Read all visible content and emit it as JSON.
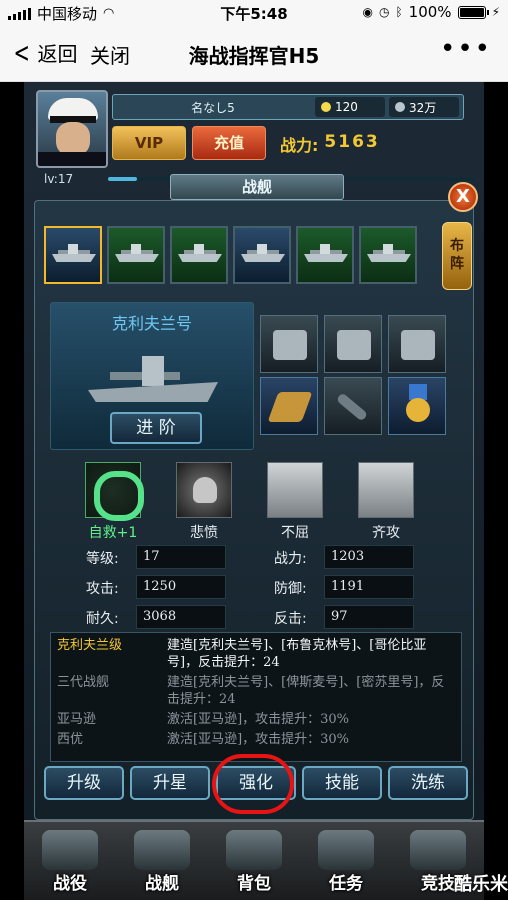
{
  "statusbar": {
    "carrier": "中国移动",
    "time": "下午5:48",
    "battery": "100%"
  },
  "navbar": {
    "back_label": "返回",
    "close_label": "关闭",
    "title": "海战指挥官H5",
    "more_label": "•••"
  },
  "player": {
    "name": "名なし5",
    "gold": "120",
    "silver": "32万",
    "level": "lv:17",
    "level_progress": 0.08,
    "vip_label": "VIP",
    "charge_label": "充值",
    "power_label": "战力:",
    "power_value": "5163"
  },
  "panel": {
    "title": "战舰",
    "close_label": "X",
    "formation_label_1": "布",
    "formation_label_2": "阵"
  },
  "ship": {
    "name": "克利夫兰号",
    "advance_label": "进 阶"
  },
  "skills": [
    {
      "name": "自救+1"
    },
    {
      "name": "悲愤"
    },
    {
      "name": "不屈"
    },
    {
      "name": "齐攻"
    }
  ],
  "stats": {
    "level_label": "等级:",
    "level_value": "17",
    "power_label": "战力:",
    "power_value": "1203",
    "attack_label": "攻击:",
    "attack_value": "1250",
    "defense_label": "防御:",
    "defense_value": "1191",
    "durability_label": "耐久:",
    "durability_value": "3068",
    "counter_label": "反击:",
    "counter_value": "97"
  },
  "descriptions": [
    {
      "k": "克利夫兰级",
      "v": "建造[克利夫兰号]、[布鲁克林号]、[哥伦比亚号]，反击提升：24",
      "state": "active"
    },
    {
      "k": "三代战舰",
      "v": "建造[克利夫兰号]、[俾斯麦号]、[密苏里号]，反击提升：24",
      "state": "dim"
    },
    {
      "k": "亚马逊",
      "v": "激活[亚马逊]，攻击提升：30%",
      "state": "dim"
    },
    {
      "k": "西优",
      "v": "激活[亚马逊]，攻击提升：30%",
      "state": "dim"
    }
  ],
  "actions": {
    "upgrade": "升级",
    "star": "升星",
    "enhance": "强化",
    "skill": "技能",
    "refine": "洗练"
  },
  "bottom_nav": {
    "campaign": "战役",
    "warship": "战舰",
    "backpack": "背包",
    "task": "任务",
    "arena": "竞技"
  },
  "watermark": "酷乐米"
}
